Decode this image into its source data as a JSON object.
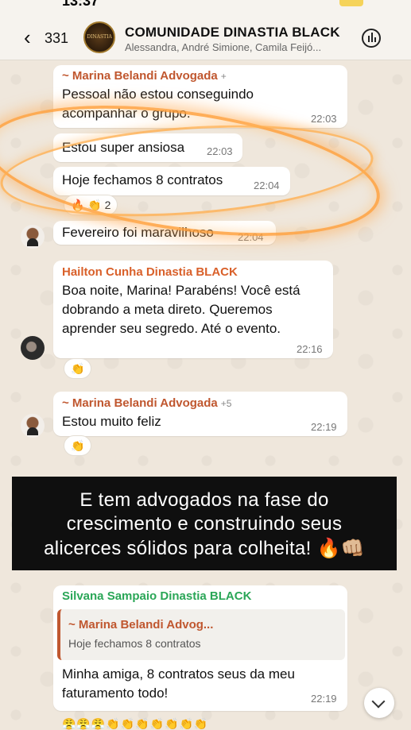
{
  "status_bar": {
    "time": "13:37"
  },
  "header": {
    "back_count": "331",
    "group_avatar_text": "DINASTIA",
    "title": "COMUNIDADE DINASTIA BLACK",
    "members": "Alessandra, André Simione, Camila Feijó..."
  },
  "messages": [
    {
      "sender": "~ Marina Belandi Advogada",
      "sender_extra": "+",
      "lines": [
        "Pessoal não estou conseguindo",
        "acompanhar o grupo."
      ],
      "time": "22:03"
    },
    {
      "lines": [
        "Estou super ansiosa"
      ],
      "time": "22:03"
    },
    {
      "lines": [
        "Hoje fechamos 8 contratos"
      ],
      "time": "22:04",
      "reaction": "🔥 👏 2"
    },
    {
      "lines": [
        "Fevereiro foi maravilhoso"
      ],
      "time": "22:04"
    },
    {
      "sender": "Hailton Cunha Dinastia BLACK",
      "lines": [
        "Boa noite, Marina! Parabéns! Você está",
        "dobrando a meta direto. Queremos",
        "aprender seu segredo. Até o evento."
      ],
      "time": "22:16",
      "reaction": "👏"
    },
    {
      "sender": "~ Marina Belandi Advogada",
      "sender_extra": "+5",
      "lines": [
        "Estou muito feliz"
      ],
      "time": "22:19",
      "reaction": "👏"
    },
    {
      "sender": "Silvana Sampaio Dinastia BLACK",
      "quote_sender": "~ Marina Belandi Advog...",
      "quote_text": "Hoje fechamos 8 contratos",
      "lines": [
        "Minha amiga, 8 contratos seus da meu",
        "faturamento todo!"
      ],
      "time": "22:19"
    }
  ],
  "caption": {
    "lines": [
      "E tem advogados na fase do",
      "crescimento e construindo seus",
      "alicerces sólidos para colheita! 🔥👊🏼"
    ]
  },
  "bottom_reactions": "😤😤😤👏👏👏👏👏👏👏",
  "colors": {
    "marina": "#c0572f",
    "hailton": "#d9602a",
    "silvana": "#2aa657",
    "highlight": "#ffa040"
  }
}
